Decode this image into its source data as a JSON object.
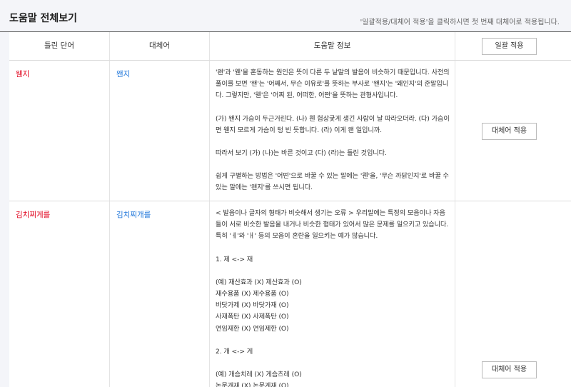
{
  "header": {
    "title": "도움말 전체보기",
    "hint": "'일괄적용/대체어 적용'을 클릭하시면 첫 번째 대체어로 적용됩니다."
  },
  "table": {
    "columns": [
      "틀린 단어",
      "대체어",
      "도움말 정보"
    ],
    "apply_all_label": "일괄 적용"
  },
  "rows": [
    {
      "wrong": "웬지",
      "replacement": "왠지",
      "apply_label": "대체어 적용",
      "info": [
        "'왠'과 '웬'을 혼동하는 원인은 뜻이 다른 두 낱말의 발음이 비슷하기 때문입니다. 사전의 풀이를 보면 '왠'는 '어째서, 무슨 이유로'를 뜻하는 부사로 '왠지'는 '왜인지'의 준말입니다. 그렇지만, '웬'은 '어찌 된, 어떠한, 어떤'을 뜻하는 관형사입니다.",
        "",
        "(가) 왠지 가슴이 두근거린다. (나) 웬 험상궂게 생긴 사람이 날 따라오더라. (다) 가슴이면 웬지 모르게 가슴이 텅 빈 듯합니다. (라) 이게 왠 일입니까.",
        "",
        "따라서 보기 (가) (나)는 바른 것이고 (다) (라)는 틀린 것입니다.",
        "",
        "쉽게 구별하는 방법은 '어떤'으로 바꿀 수 있는 말에는 '웬'을, '무슨 까닭인지'로 바꿀 수 있는 말에는 '왠지'를 쓰시면 됩니다."
      ]
    },
    {
      "wrong": "김치찌게를",
      "replacement": "김치찌개를",
      "apply_label": "대체어 적용",
      "info": [
        "< 발음이나 글자의 형태가 비슷해서 생기는 오류 > 우리말에는 특정의 모음이나 자음들이 서로 비슷한 발음을 내거나 비슷한 형태가 있어서 많은 문제를 일으키고 있습니다. 특히 'ㅔ'와 'ㅐ' 등의 모음이 혼란을 일으키는 예가 많습니다.",
        "",
        "1. 제 <-> 재",
        "",
        "(예) 재산효과 (X) 제산효과 (O)",
        "재수용품 (X) 제수용품 (O)",
        "바닷가제 (X) 바닷가재 (O)",
        "사재폭탄 (X) 사제폭탄 (O)",
        "연임재한 (X) 연임제한 (O)",
        "",
        "2. 개 <-> 게",
        "",
        "(예) 개슴치레 (X) 게슴츠레 (O)",
        "논문개재 (X) 논문게재 (O)"
      ]
    }
  ]
}
